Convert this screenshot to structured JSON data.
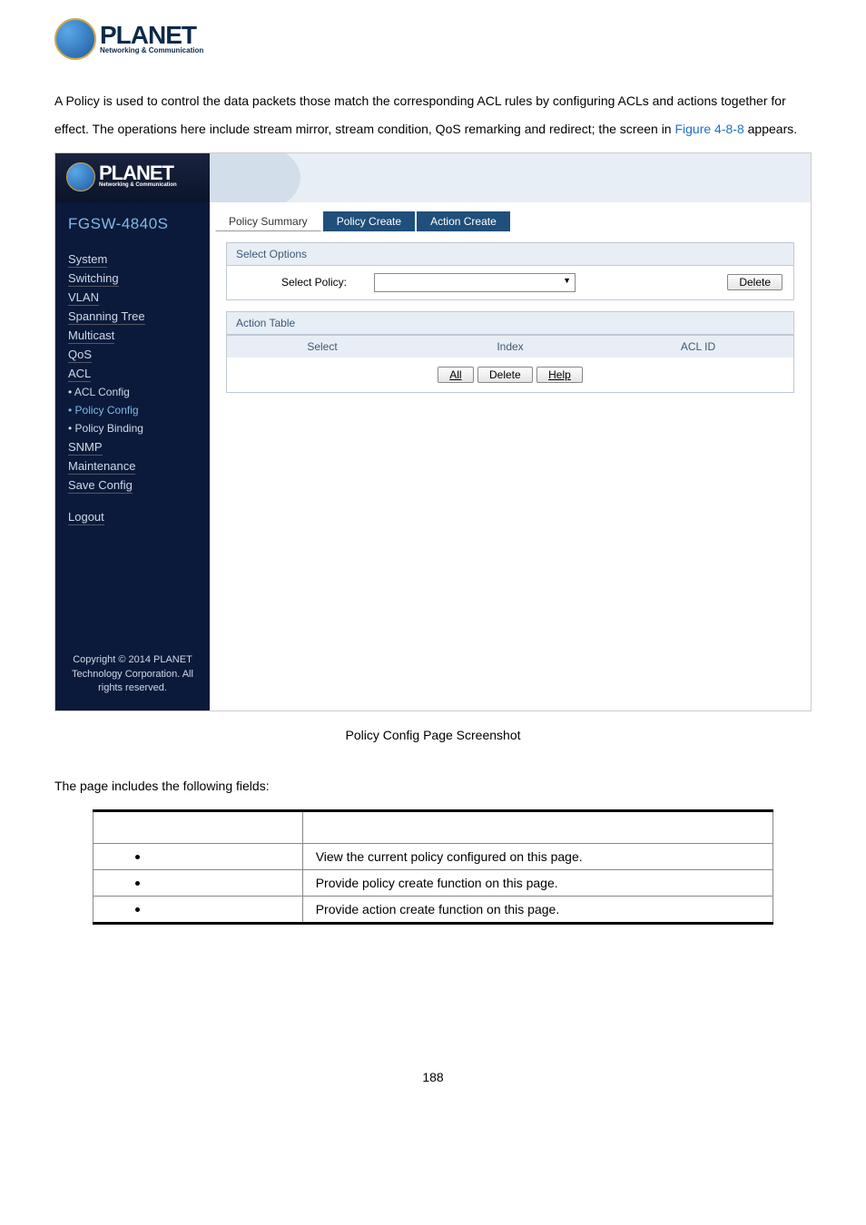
{
  "logo": {
    "brand": "PLANET",
    "tagline": "Networking & Communication"
  },
  "intro": {
    "text_part1": "A Policy is used to control the data packets those match the corresponding ACL rules by configuring ACLs and actions together for effect. The operations here include stream mirror, stream condition, QoS remarking and redirect; the screen in ",
    "figure_ref": "Figure 4-8-8",
    "text_part2": " appears."
  },
  "app": {
    "device": "FGSW-4840S",
    "nav": {
      "items": [
        "System",
        "Switching",
        "VLAN",
        "Spanning Tree",
        "Multicast",
        "QoS",
        "ACL"
      ],
      "subitems": [
        {
          "label": "ACL Config",
          "active": false
        },
        {
          "label": "Policy Config",
          "active": true
        },
        {
          "label": "Policy Binding",
          "active": false
        }
      ],
      "items2": [
        "SNMP",
        "Maintenance",
        "Save Config"
      ],
      "logout": "Logout"
    },
    "copyright": "Copyright © 2014 PLANET Technology Corporation. All rights reserved.",
    "tabs": [
      {
        "label": "Policy Summary",
        "active": false
      },
      {
        "label": "Policy Create",
        "active": true
      },
      {
        "label": "Action Create",
        "active": true
      }
    ],
    "select_options": {
      "title": "Select Options",
      "label": "Select Policy:",
      "delete_btn": "Delete"
    },
    "action_table": {
      "title": "Action Table",
      "headers": {
        "select": "Select",
        "index": "Index",
        "aclid": "ACL ID"
      },
      "buttons": {
        "all": "All",
        "delete": "Delete",
        "help": "Help"
      }
    }
  },
  "caption": "Policy Config Page Screenshot",
  "fields_intro": "The page includes the following fields:",
  "fields_table": {
    "rows": [
      {
        "desc": "View the current policy configured on this page."
      },
      {
        "desc": "Provide policy create function on this page."
      },
      {
        "desc": "Provide action create function on this page."
      }
    ]
  },
  "page_number": "188"
}
